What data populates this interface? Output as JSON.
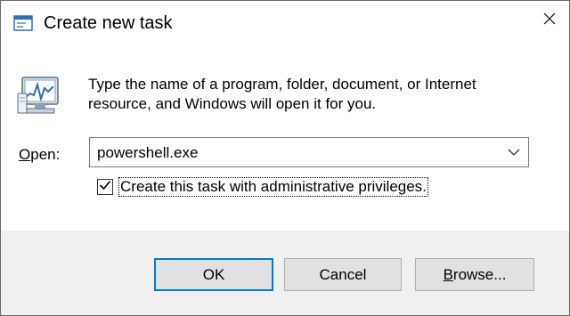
{
  "window": {
    "title": "Create new task",
    "title_icon": "run-dialog-icon",
    "close_icon": "close-icon"
  },
  "main": {
    "icon": "task-manager-icon",
    "description": "Type the name of a program, folder, document, or Internet resource, and Windows will open it for you.",
    "open_label_mnemonic": "O",
    "open_label_rest": "pen:",
    "open_value": "powershell.exe",
    "dropdown_icon": "chevron-down-icon",
    "admin_checkbox_checked": true,
    "admin_checkbox_label": "Create this task with administrative privileges."
  },
  "buttons": {
    "ok_label": "OK",
    "cancel_label": "Cancel",
    "browse_mnemonic": "B",
    "browse_rest": "rowse..."
  },
  "colors": {
    "accent": "#0078d7",
    "footer_bg": "#f0f0f0",
    "button_bg": "#e1e1e1"
  }
}
